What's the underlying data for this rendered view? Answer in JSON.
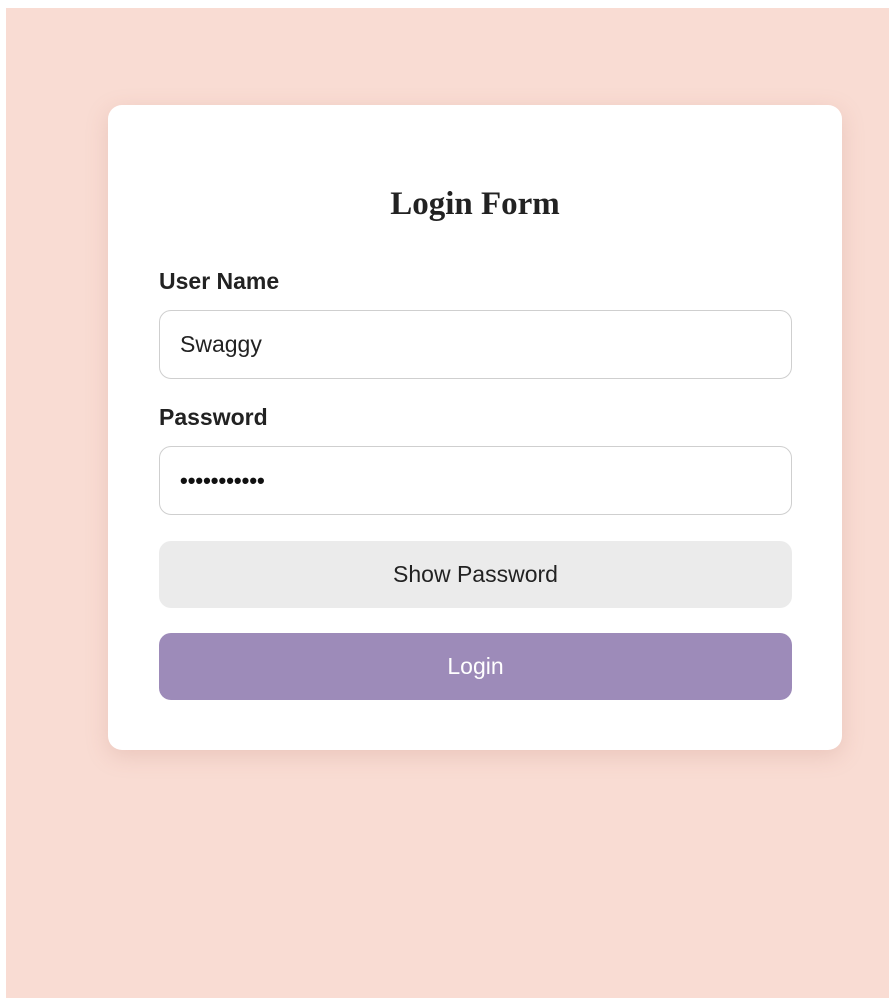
{
  "form": {
    "title": "Login Form",
    "username_label": "User Name",
    "username_value": "Swaggy",
    "password_label": "Password",
    "password_masked": "•••••••••••",
    "show_password_label": "Show Password",
    "login_label": "Login"
  },
  "colors": {
    "page_background": "#f9dcd3",
    "card_background": "#ffffff",
    "login_button": "#9d8bb9",
    "show_button": "#ebebeb"
  }
}
